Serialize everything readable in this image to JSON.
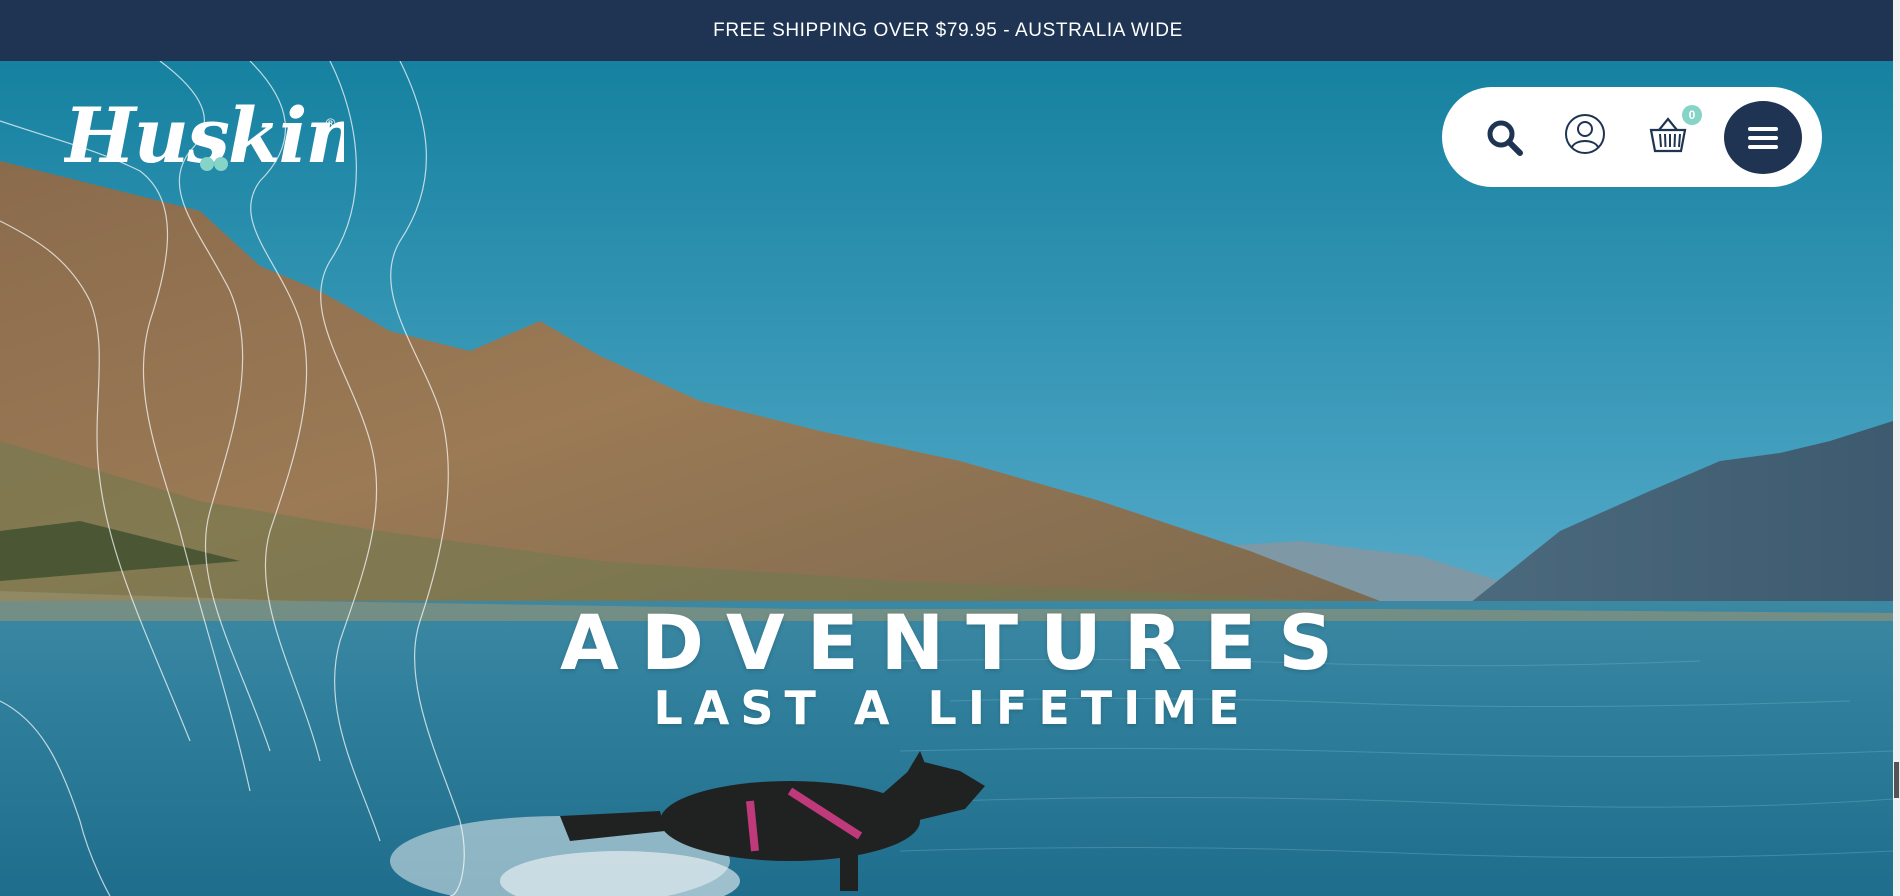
{
  "announcement": {
    "text": "FREE SHIPPING OVER $79.95 - AUSTRALIA WIDE"
  },
  "logo": {
    "text": "Huskimo",
    "registered": "®"
  },
  "header": {
    "icons": {
      "search": "search-icon",
      "account": "user-account-icon",
      "cart": "shopping-basket-icon",
      "menu": "hamburger-menu-icon"
    },
    "cart_count": "0"
  },
  "hero": {
    "headline": "ADVENTURES",
    "subheadline": "LAST A LIFETIME"
  },
  "colors": {
    "navy": "#1e3452",
    "mint_accent": "#86d3c7",
    "white": "#ffffff"
  }
}
